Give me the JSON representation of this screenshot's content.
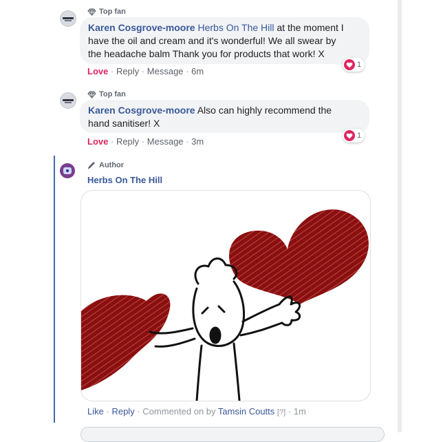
{
  "comments": [
    {
      "badge": "Top fan",
      "author": "Karen Cosgrove-moore",
      "mention": "Herbs On The Hill",
      "text_line1": "at the moment I",
      "text_line2": "have the oil and cream and it's wonderful! We all swear by",
      "text_line3": "the headache balm Thank you for products that work! X",
      "actions": {
        "love": "Love",
        "reply": "Reply",
        "message": "Message",
        "time": "6m",
        "sep": "·"
      },
      "reaction_count": "1"
    },
    {
      "badge": "Top fan",
      "author": "Karen Cosgrove-moore",
      "text_line1": "Also can highly recommend the",
      "text_line2": "hand sanitiser! X",
      "actions": {
        "love": "Love",
        "reply": "Reply",
        "message": "Message",
        "time": "3m",
        "sep": "·"
      },
      "reaction_count": "1"
    }
  ],
  "author_reply": {
    "badge": "Author",
    "author": "Herbs On The Hill",
    "image_alt": "drawing of a person with arms open between two red hearts",
    "actions": {
      "like": "Like",
      "reply": "Reply",
      "commented_on_by": "Commented on by",
      "commenter": "Tamsin Coutts",
      "help": "[?]",
      "time": "1m",
      "sep": "·"
    }
  },
  "colors": {
    "link_blue": "#385898",
    "love_red": "#e0245e",
    "heart_drawing": "#8b0f0f",
    "thread_line": "#4267b2"
  },
  "icons": [
    "diamond-icon",
    "pen-icon",
    "heart-reaction-icon"
  ]
}
